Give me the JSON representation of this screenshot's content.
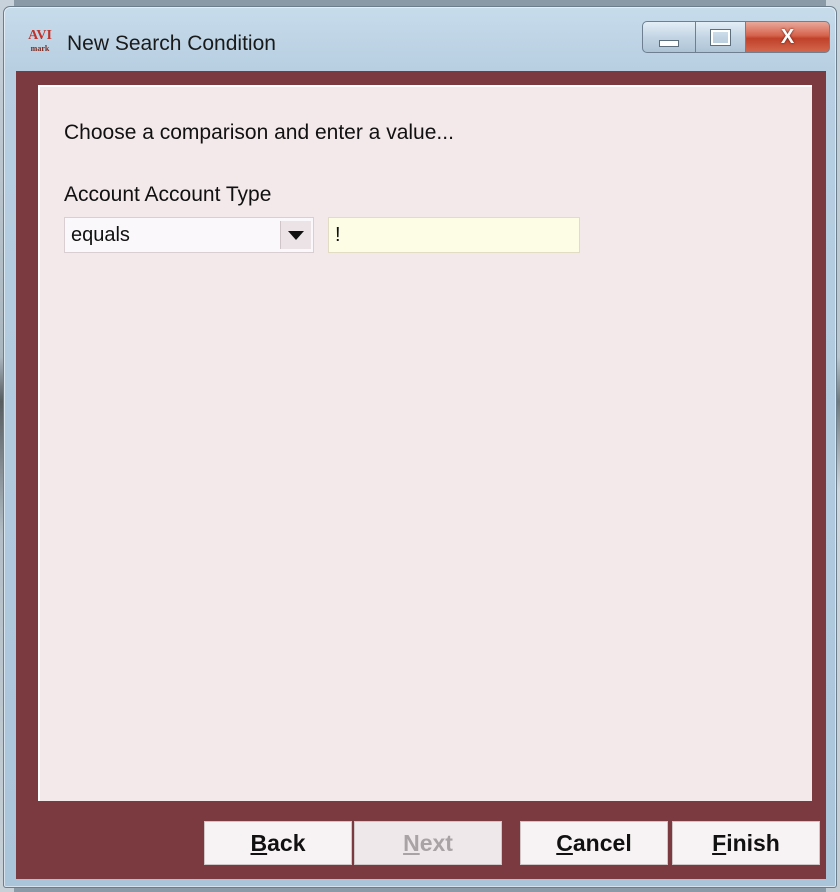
{
  "window": {
    "title": "New Search Condition",
    "app_icon_text": "AVI",
    "app_icon_subtext": "mark",
    "close_glyph": "X"
  },
  "content": {
    "instruction": "Choose a comparison and enter a value...",
    "field_label": "Account Account Type",
    "comparison": {
      "selected": "equals"
    },
    "value_input": {
      "value": "!"
    }
  },
  "buttons": {
    "back": {
      "first": "B",
      "rest": "ack",
      "enabled": true
    },
    "next": {
      "first": "N",
      "rest": "ext",
      "enabled": false
    },
    "cancel": {
      "first": "C",
      "rest": "ancel",
      "enabled": true
    },
    "finish": {
      "first": "F",
      "rest": "inish",
      "enabled": true
    }
  },
  "colors": {
    "frame": "#7a3a40",
    "panel": "#f3e9ea",
    "input_bg": "#fdfce4",
    "close_button": "#c0412a"
  }
}
